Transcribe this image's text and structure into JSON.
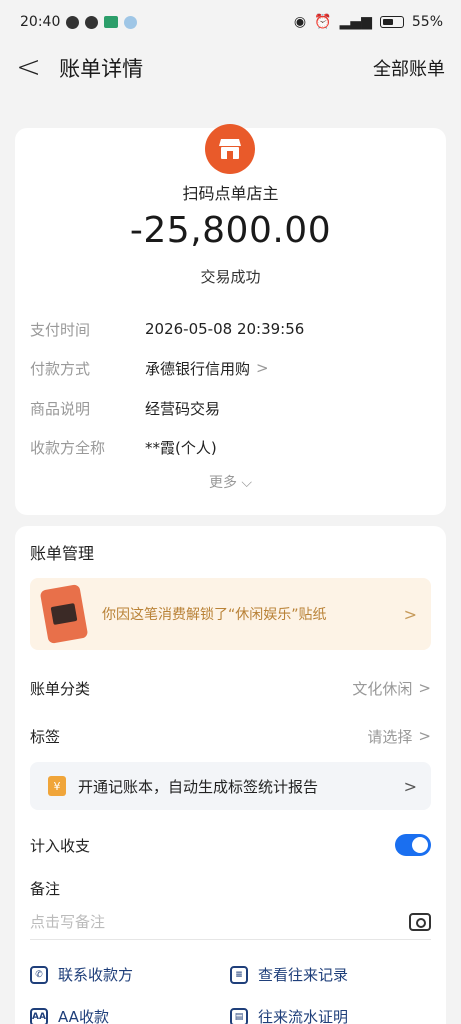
{
  "status_bar": {
    "time": "20:40",
    "battery": "55%"
  },
  "header": {
    "back": "<",
    "title": "账单详情",
    "all_bills": "全部账单"
  },
  "transaction": {
    "merchant": "扫码点单店主",
    "amount": "-25,800.00",
    "status": "交易成功",
    "details": [
      {
        "label": "支付时间",
        "value": "2026-05-08 20:39:56"
      },
      {
        "label": "付款方式",
        "value": "承德银行信用购"
      },
      {
        "label": "商品说明",
        "value": "经营码交易"
      },
      {
        "label": "收款方全称",
        "value": "**霞(个人)"
      }
    ],
    "more": "更多"
  },
  "management": {
    "title": "账单管理",
    "sticker_text": "你因这笔消费解锁了“休闲娱乐”贴纸",
    "category_label": "账单分类",
    "category_value": "文化休闲",
    "tag_label": "标签",
    "tag_value": "请选择",
    "promo_text": "开通记账本，自动生成标签统计报告",
    "income_label": "计入收支",
    "income_toggle_on": true,
    "note_label": "备注",
    "note_placeholder": "点击写备注",
    "actions": [
      {
        "label": "联系收款方",
        "icon": "phone-icon"
      },
      {
        "label": "查看往来记录",
        "icon": "search-record-icon"
      },
      {
        "label": "AA收款",
        "icon": "aa-icon"
      },
      {
        "label": "往来流水证明",
        "icon": "document-icon"
      }
    ]
  },
  "colors": {
    "accent_blue": "#1a6ff0",
    "merchant_orange": "#e95a2a",
    "sticker_text": "#b98237",
    "link_blue": "#1f3f7a"
  }
}
